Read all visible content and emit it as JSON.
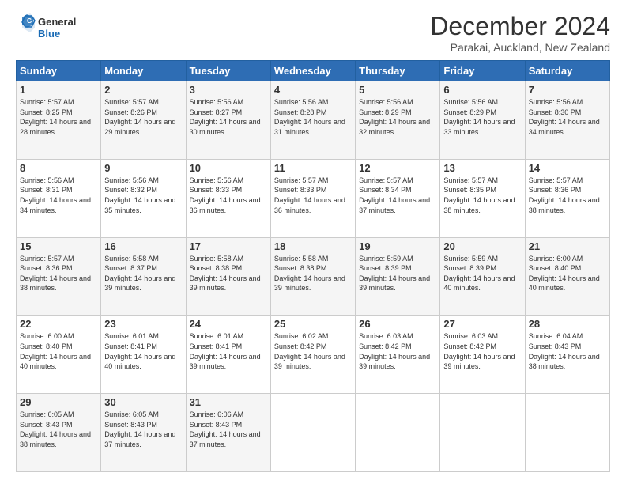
{
  "header": {
    "logo_general": "General",
    "logo_blue": "Blue",
    "month_title": "December 2024",
    "location": "Parakai, Auckland, New Zealand"
  },
  "weekdays": [
    "Sunday",
    "Monday",
    "Tuesday",
    "Wednesday",
    "Thursday",
    "Friday",
    "Saturday"
  ],
  "weeks": [
    [
      {
        "day": "1",
        "sunrise": "5:57 AM",
        "sunset": "8:25 PM",
        "daylight": "14 hours and 28 minutes."
      },
      {
        "day": "2",
        "sunrise": "5:57 AM",
        "sunset": "8:26 PM",
        "daylight": "14 hours and 29 minutes."
      },
      {
        "day": "3",
        "sunrise": "5:56 AM",
        "sunset": "8:27 PM",
        "daylight": "14 hours and 30 minutes."
      },
      {
        "day": "4",
        "sunrise": "5:56 AM",
        "sunset": "8:28 PM",
        "daylight": "14 hours and 31 minutes."
      },
      {
        "day": "5",
        "sunrise": "5:56 AM",
        "sunset": "8:29 PM",
        "daylight": "14 hours and 32 minutes."
      },
      {
        "day": "6",
        "sunrise": "5:56 AM",
        "sunset": "8:29 PM",
        "daylight": "14 hours and 33 minutes."
      },
      {
        "day": "7",
        "sunrise": "5:56 AM",
        "sunset": "8:30 PM",
        "daylight": "14 hours and 34 minutes."
      }
    ],
    [
      {
        "day": "8",
        "sunrise": "5:56 AM",
        "sunset": "8:31 PM",
        "daylight": "14 hours and 34 minutes."
      },
      {
        "day": "9",
        "sunrise": "5:56 AM",
        "sunset": "8:32 PM",
        "daylight": "14 hours and 35 minutes."
      },
      {
        "day": "10",
        "sunrise": "5:56 AM",
        "sunset": "8:33 PM",
        "daylight": "14 hours and 36 minutes."
      },
      {
        "day": "11",
        "sunrise": "5:57 AM",
        "sunset": "8:33 PM",
        "daylight": "14 hours and 36 minutes."
      },
      {
        "day": "12",
        "sunrise": "5:57 AM",
        "sunset": "8:34 PM",
        "daylight": "14 hours and 37 minutes."
      },
      {
        "day": "13",
        "sunrise": "5:57 AM",
        "sunset": "8:35 PM",
        "daylight": "14 hours and 38 minutes."
      },
      {
        "day": "14",
        "sunrise": "5:57 AM",
        "sunset": "8:36 PM",
        "daylight": "14 hours and 38 minutes."
      }
    ],
    [
      {
        "day": "15",
        "sunrise": "5:57 AM",
        "sunset": "8:36 PM",
        "daylight": "14 hours and 38 minutes."
      },
      {
        "day": "16",
        "sunrise": "5:58 AM",
        "sunset": "8:37 PM",
        "daylight": "14 hours and 39 minutes."
      },
      {
        "day": "17",
        "sunrise": "5:58 AM",
        "sunset": "8:38 PM",
        "daylight": "14 hours and 39 minutes."
      },
      {
        "day": "18",
        "sunrise": "5:58 AM",
        "sunset": "8:38 PM",
        "daylight": "14 hours and 39 minutes."
      },
      {
        "day": "19",
        "sunrise": "5:59 AM",
        "sunset": "8:39 PM",
        "daylight": "14 hours and 39 minutes."
      },
      {
        "day": "20",
        "sunrise": "5:59 AM",
        "sunset": "8:39 PM",
        "daylight": "14 hours and 40 minutes."
      },
      {
        "day": "21",
        "sunrise": "6:00 AM",
        "sunset": "8:40 PM",
        "daylight": "14 hours and 40 minutes."
      }
    ],
    [
      {
        "day": "22",
        "sunrise": "6:00 AM",
        "sunset": "8:40 PM",
        "daylight": "14 hours and 40 minutes."
      },
      {
        "day": "23",
        "sunrise": "6:01 AM",
        "sunset": "8:41 PM",
        "daylight": "14 hours and 40 minutes."
      },
      {
        "day": "24",
        "sunrise": "6:01 AM",
        "sunset": "8:41 PM",
        "daylight": "14 hours and 39 minutes."
      },
      {
        "day": "25",
        "sunrise": "6:02 AM",
        "sunset": "8:42 PM",
        "daylight": "14 hours and 39 minutes."
      },
      {
        "day": "26",
        "sunrise": "6:03 AM",
        "sunset": "8:42 PM",
        "daylight": "14 hours and 39 minutes."
      },
      {
        "day": "27",
        "sunrise": "6:03 AM",
        "sunset": "8:42 PM",
        "daylight": "14 hours and 39 minutes."
      },
      {
        "day": "28",
        "sunrise": "6:04 AM",
        "sunset": "8:43 PM",
        "daylight": "14 hours and 38 minutes."
      }
    ],
    [
      {
        "day": "29",
        "sunrise": "6:05 AM",
        "sunset": "8:43 PM",
        "daylight": "14 hours and 38 minutes."
      },
      {
        "day": "30",
        "sunrise": "6:05 AM",
        "sunset": "8:43 PM",
        "daylight": "14 hours and 37 minutes."
      },
      {
        "day": "31",
        "sunrise": "6:06 AM",
        "sunset": "8:43 PM",
        "daylight": "14 hours and 37 minutes."
      },
      null,
      null,
      null,
      null
    ]
  ]
}
